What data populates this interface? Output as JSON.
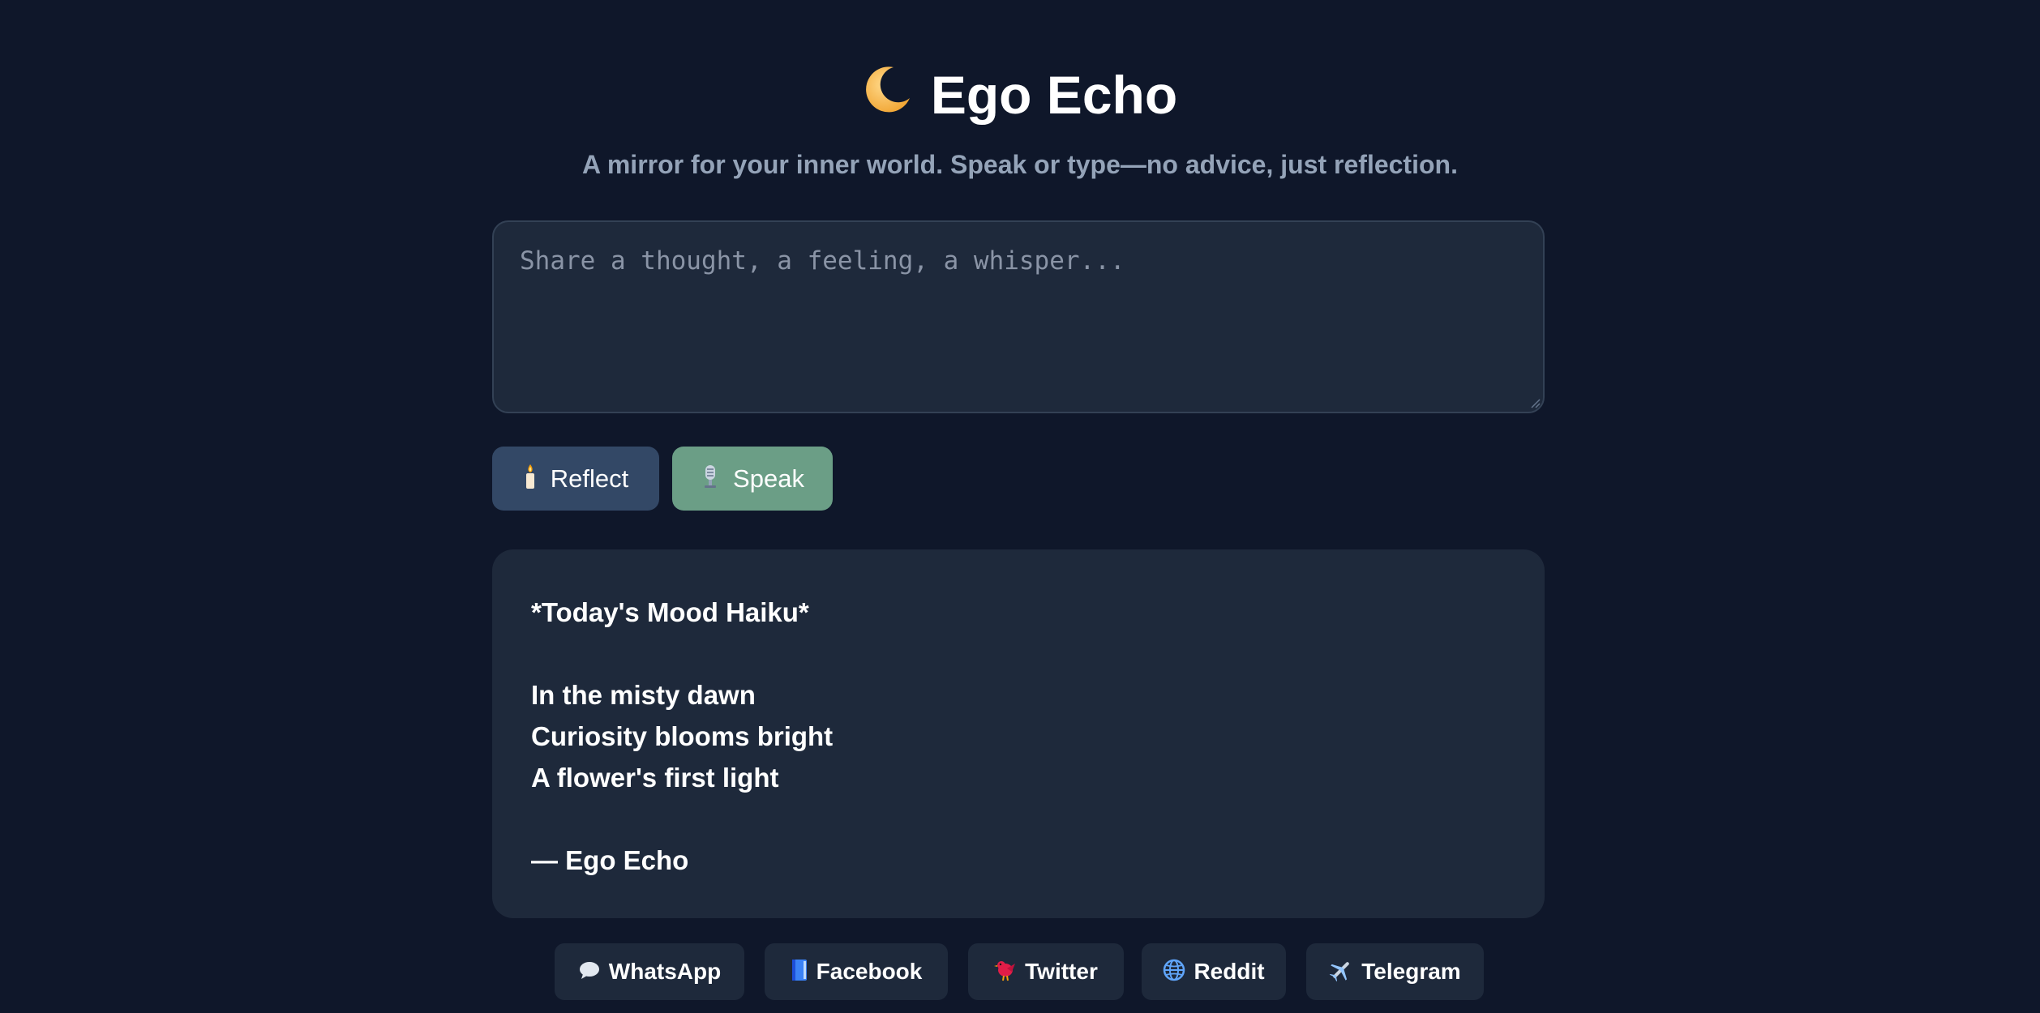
{
  "header": {
    "title": "Ego Echo",
    "title_icon": "crescent-moon-icon",
    "subtitle": "A mirror for your inner world. Speak or type—no advice, just reflection."
  },
  "input": {
    "placeholder": "Share a thought, a feeling, a whisper...",
    "value": ""
  },
  "actions": {
    "reflect_label": "Reflect",
    "reflect_icon": "candle-icon",
    "speak_label": "Speak",
    "speak_icon": "microphone-icon"
  },
  "output": {
    "lines": [
      "*Today's Mood Haiku*",
      "",
      "In the misty dawn",
      "Curiosity blooms bright",
      "A flower's first light",
      "",
      "— Ego Echo"
    ]
  },
  "share": {
    "buttons": [
      {
        "label": "WhatsApp",
        "icon": "speech-bubble-icon"
      },
      {
        "label": "Facebook",
        "icon": "blue-book-icon"
      },
      {
        "label": "Twitter",
        "icon": "bird-icon"
      },
      {
        "label": "Reddit",
        "icon": "globe-icon"
      },
      {
        "label": "Telegram",
        "icon": "airplane-icon"
      }
    ]
  },
  "colors": {
    "background": "#0f172a",
    "card": "#1e293b",
    "reflect_button": "#334866",
    "speak_button": "#6b9e86",
    "subtitle": "#94a3b8"
  }
}
